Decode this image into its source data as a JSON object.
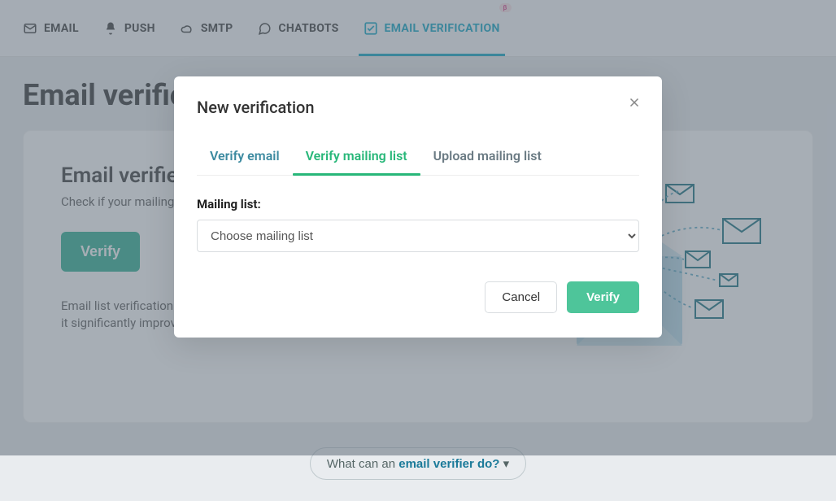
{
  "nav": {
    "items": [
      {
        "label": "EMAIL"
      },
      {
        "label": "PUSH"
      },
      {
        "label": "SMTP"
      },
      {
        "label": "CHATBOTS"
      },
      {
        "label": "EMAIL VERIFICATION",
        "badge": "β"
      }
    ]
  },
  "page": {
    "title": "Email verification",
    "card": {
      "heading": "Email verifier",
      "lead": "Check if your mailing lists contain valid emails.",
      "verify_label": "Verify",
      "note": "Email list verification does not guarantee that a campaign skips moderation, but it significantly improves deliverability."
    },
    "info_pill_prefix": "What can an ",
    "info_pill_strong": "email verifier do?",
    "info_pill_chevron": "▾"
  },
  "modal": {
    "title": "New verification",
    "tabs": [
      {
        "label": "Verify email"
      },
      {
        "label": "Verify mailing list"
      },
      {
        "label": "Upload mailing list"
      }
    ],
    "field_label": "Mailing list:",
    "select_placeholder": "Choose mailing list",
    "cancel_label": "Cancel",
    "verify_label": "Verify"
  }
}
